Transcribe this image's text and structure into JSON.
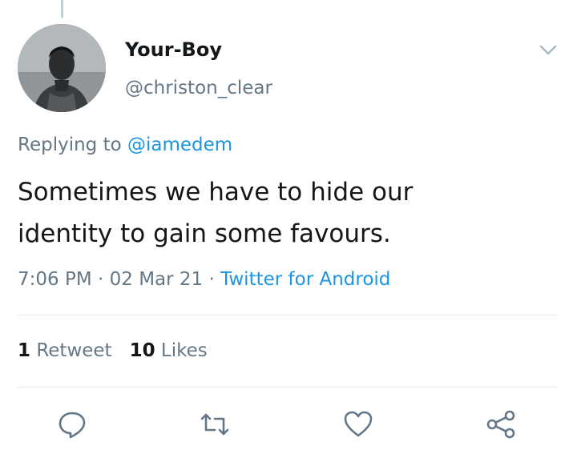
{
  "tweet": {
    "author": {
      "display_name": "Your-Boy",
      "handle": "@christon_clear",
      "avatar": "profile-photo"
    },
    "replying_prefix": "Replying to",
    "replying_to": "@iamedem",
    "text_line1": "Sometimes we have to hide our",
    "text_line2": "identity to gain some favours.",
    "time": "7:06 PM",
    "date": "02 Mar 21",
    "separator": "·",
    "source": "Twitter for Android",
    "stats": {
      "retweets_count": "1",
      "retweets_label": "Retweet",
      "likes_count": "10",
      "likes_label": "Likes"
    },
    "actions": [
      "reply-icon",
      "retweet-icon",
      "like-icon",
      "share-icon"
    ]
  },
  "colors": {
    "text": "#14171a",
    "secondary": "#657786",
    "link": "#1b95e0",
    "divider": "#e1e8ed",
    "icon": "#657786"
  }
}
